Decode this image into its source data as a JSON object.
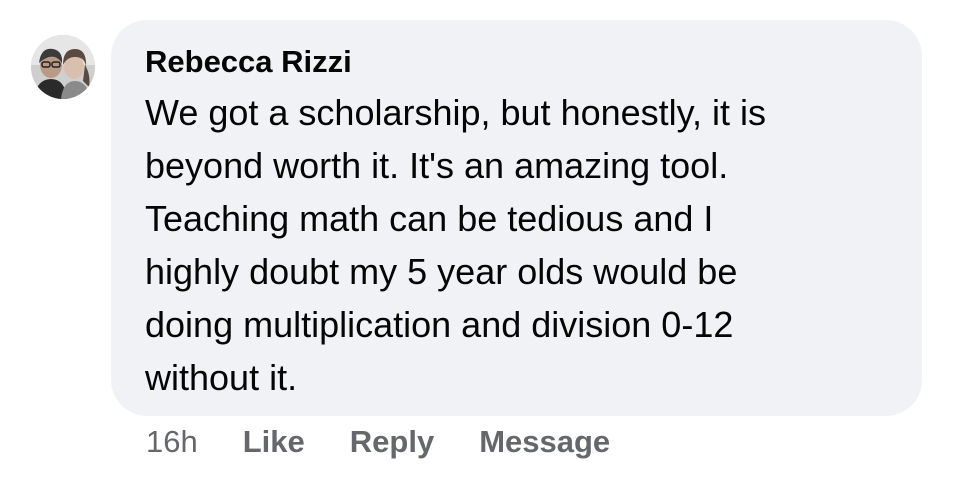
{
  "comment": {
    "author": "Rebecca Rizzi",
    "text_lines": [
      "We got a scholarship, but honestly, it is",
      "beyond worth it. It's an amazing tool.",
      "Teaching math can be tedious and I",
      "highly doubt my 5 year olds would be",
      "doing multiplication and division 0-12",
      "without it."
    ],
    "timestamp": "16h",
    "actions": {
      "like": "Like",
      "reply": "Reply",
      "message": "Message"
    }
  },
  "colors": {
    "bubble_background": "#f0f2f5",
    "text": "#050505",
    "secondary_text": "#65676b"
  },
  "icons": {
    "avatar": "profile-photo"
  }
}
